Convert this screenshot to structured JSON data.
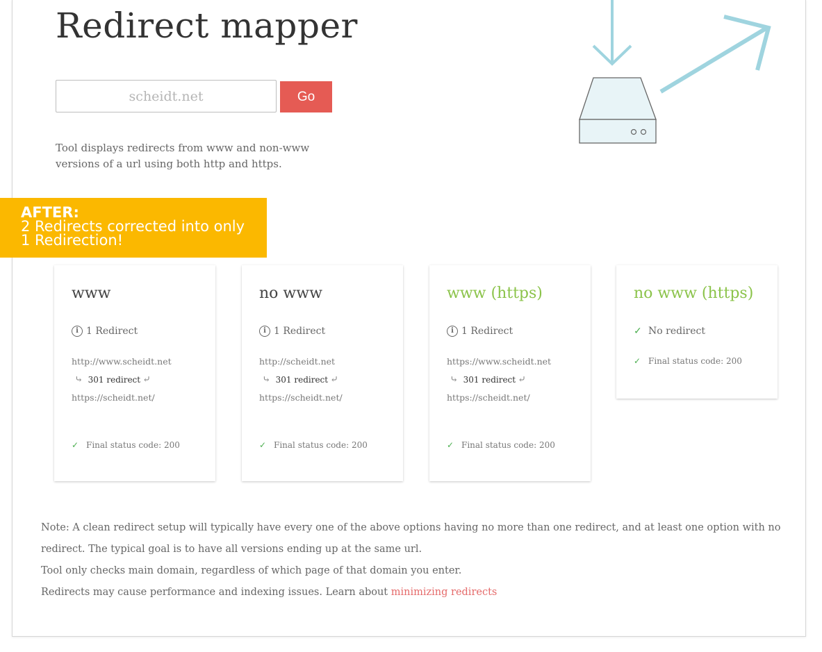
{
  "header": {
    "title": "Redirect mapper"
  },
  "search": {
    "placeholder": "scheidt.net",
    "go_label": "Go"
  },
  "description": "Tool displays redirects from www and non-www versions of a url using both http and https.",
  "banner": {
    "heading": "AFTER:",
    "line1": "2 Redirects corrected into only",
    "line2": "1 Redirection!",
    "color": "#fbb800"
  },
  "cards": [
    {
      "title": "www",
      "status": "1 Redirect",
      "from_url": "http://www.scheidt.net",
      "redirect_label": "301 redirect",
      "to_url": "https://scheidt.net/",
      "final_status": "Final status code: 200"
    },
    {
      "title": "no www",
      "status": "1 Redirect",
      "from_url": "http://scheidt.net",
      "redirect_label": "301 redirect",
      "to_url": "https://scheidt.net/",
      "final_status": "Final status code: 200"
    },
    {
      "title": "www (https)",
      "status": "1 Redirect",
      "from_url": "https://www.scheidt.net",
      "redirect_label": "301 redirect",
      "to_url": "https://scheidt.net/",
      "final_status": "Final status code: 200"
    },
    {
      "title": "no www (https)",
      "status": "No redirect",
      "final_status": "Final status code: 200"
    }
  ],
  "notes": {
    "line1": "Note: A clean redirect setup will typically have every one of the above options having no more than one redirect, and at least one option with no redirect. The typical goal is to have all versions ending up at the same url.",
    "line2": "Tool only checks main domain, regardless of which page of that domain you enter.",
    "line3_prefix": "Redirects may cause performance and indexing issues. Learn about ",
    "line3_link": "minimizing redirects"
  },
  "colors": {
    "accent_red": "#e55b54",
    "success_green": "#8bc34a",
    "check_green": "#4caf50",
    "illustration_blue": "#9fd4df"
  }
}
